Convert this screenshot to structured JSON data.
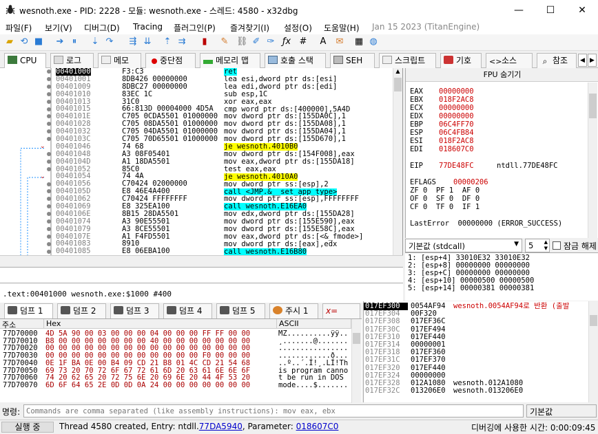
{
  "window": {
    "title": "wesnoth.exe - PID: 2228 - 모듈: wesnoth.exe - 스레드: 4580 - x32dbg",
    "minimize": "—",
    "maximize": "☐",
    "close": "✕"
  },
  "menu": [
    "파일(F)",
    "보기(V)",
    "디버그(D)",
    "Tracing",
    "플러그인(P)",
    "즐겨찾기(I)",
    "설정(O)",
    "도움말(H)"
  ],
  "menu_date": "Jan 15 2023 (TitanEngine)",
  "tabs": [
    {
      "label": "CPU",
      "icon": "cpu-icon"
    },
    {
      "label": "로그",
      "icon": "log-icon"
    },
    {
      "label": "메모",
      "icon": "notes-icon"
    },
    {
      "label": "중단점",
      "icon": "breakpoint-icon"
    },
    {
      "label": "메모리 맵",
      "icon": "memory-map-icon"
    },
    {
      "label": "호출 스택",
      "icon": "call-stack-icon"
    },
    {
      "label": "SEH",
      "icon": "seh-icon"
    },
    {
      "label": "스크립트",
      "icon": "script-icon"
    },
    {
      "label": "기호",
      "icon": "symbols-icon"
    },
    {
      "label": "소스",
      "icon": "source-icon"
    },
    {
      "label": "참조",
      "icon": "references-icon"
    }
  ],
  "disasm": {
    "rows": [
      {
        "addr": "00401000",
        "bytes": "F3:C3",
        "ins": "ret",
        "style": "ret",
        "cur": true
      },
      {
        "addr": "00401001",
        "bytes": "8DB426 00000000",
        "ins": "lea esi,dword ptr ds:[esi]"
      },
      {
        "addr": "00401009",
        "bytes": "8DBC27 00000000",
        "ins": "lea edi,dword ptr ds:[edi]"
      },
      {
        "addr": "00401010",
        "bytes": "83EC 1C",
        "ins": "sub esp,1C"
      },
      {
        "addr": "00401013",
        "bytes": "31C0",
        "ins": "xor eax,eax"
      },
      {
        "addr": "00401015",
        "bytes": "66:813D 00004000 4D5A",
        "ins": "cmp word ptr ds:[400000],5A4D"
      },
      {
        "addr": "0040101E",
        "bytes": "C705 0CDA5501 01000000",
        "ins": "mov dword ptr ds:[155DA0C],1"
      },
      {
        "addr": "00401028",
        "bytes": "C705 08DA5501 01000000",
        "ins": "mov dword ptr ds:[155DA08],1"
      },
      {
        "addr": "00401032",
        "bytes": "C705 04DA5501 01000000",
        "ins": "mov dword ptr ds:[155DA04],1"
      },
      {
        "addr": "0040103C",
        "bytes": "C705 70D65501 01000000",
        "ins": "mov dword ptr ds:[155D670],1"
      },
      {
        "addr": "00401046",
        "bytes": "74 68",
        "ins": "je wesnoth.4010B0",
        "style": "jmp"
      },
      {
        "addr": "00401048",
        "bytes": "A3 08F05401",
        "ins": "mov dword ptr ds:[154F008],eax"
      },
      {
        "addr": "0040104D",
        "bytes": "A1 18DA5501",
        "ins": "mov eax,dword ptr ds:[155DA18]"
      },
      {
        "addr": "00401052",
        "bytes": "85C0",
        "ins": "test eax,eax"
      },
      {
        "addr": "00401054",
        "bytes": "74 4A",
        "ins": "je wesnoth.4010A0",
        "style": "jmp"
      },
      {
        "addr": "00401056",
        "bytes": "C70424 02000000",
        "ins": "mov dword ptr ss:[esp],2"
      },
      {
        "addr": "0040105D",
        "bytes": "E8 46E4A400",
        "ins": "call <JMP.&__set_app_type>",
        "style": "call"
      },
      {
        "addr": "00401062",
        "bytes": "C70424 FFFFFFFF",
        "ins": "mov dword ptr ss:[esp],FFFFFFFF"
      },
      {
        "addr": "00401069",
        "bytes": "E8 325EA100",
        "ins": "call wesnoth.E16EA0",
        "style": "call"
      },
      {
        "addr": "0040106E",
        "bytes": "8B15 28DA5501",
        "ins": "mov edx,dword ptr ds:[155DA28]"
      },
      {
        "addr": "00401074",
        "bytes": "A3 90E55501",
        "ins": "mov dword ptr ds:[155E590],eax"
      },
      {
        "addr": "00401079",
        "bytes": "A3 8CE55501",
        "ins": "mov dword ptr ds:[155E58C],eax"
      },
      {
        "addr": "0040107E",
        "bytes": "A1 F4FD5501",
        "ins": "mov eax,dword ptr ds:[<&_fmode>]"
      },
      {
        "addr": "00401083",
        "bytes": "8910",
        "ins": "mov dword ptr ds:[eax],edx"
      },
      {
        "addr": "00401085",
        "bytes": "E8 06EBA100",
        "ins": "call wesnoth.E16B80",
        "style": "call"
      }
    ]
  },
  "info": {
    "line": ".text:00401000 wesnoth.exe:$1000 #400"
  },
  "fpu": {
    "header": "FPU 숨기기",
    "regs": [
      {
        "n": "EAX",
        "v": "00000000"
      },
      {
        "n": "EBX",
        "v": "018F2AC8"
      },
      {
        "n": "ECX",
        "v": "00000000"
      },
      {
        "n": "EDX",
        "v": "00000000"
      },
      {
        "n": "EBP",
        "v": "06C4FF70"
      },
      {
        "n": "ESP",
        "v": "06C4FB84"
      },
      {
        "n": "ESI",
        "v": "018F2AC8"
      },
      {
        "n": "EDI",
        "v": "018607C0"
      }
    ],
    "eip": {
      "n": "EIP",
      "v": "77DE48FC",
      "c": "ntdll.77DE48FC"
    },
    "eflags": {
      "n": "EFLAGS",
      "v": "00000206"
    },
    "flags": [
      "ZF 0  PF 1  AF 0",
      "OF 0  SF 0  DF 0",
      "CF 0  TF 0  IF 1"
    ],
    "lasterror": "LastError  00000000 (ERROR_SUCCESS)"
  },
  "stackargs": {
    "callconv": "기본값 (stdcall)",
    "count": "5",
    "unlock_label": "잠금 해제",
    "rows": [
      "1: [esp+4] 33010E32 33010E32",
      "2: [esp+8] 00000000 00000000",
      "3: [esp+C] 00000000 00000000",
      "4: [esp+10] 00000500 00000500",
      "5: [esp+14] 00000381 00000381"
    ]
  },
  "dumptabs": [
    "덤프 1",
    "덤프 2",
    "덤프 3",
    "덤프 4",
    "덤프 5",
    "주시 1"
  ],
  "dump": {
    "h_addr": "주소",
    "h_hex": "Hex",
    "h_ascii": "ASCII",
    "rows": [
      {
        "a": "77D70000",
        "h": "4D 5A 90 00 03 00 00 00 04 00 00 00 FF FF 00 00",
        "s": "MZ..........ÿÿ.."
      },
      {
        "a": "77D70010",
        "h": "B8 00 00 00 00 00 00 00 40 00 00 00 00 00 00 00",
        "s": "¸.......@......."
      },
      {
        "a": "77D70020",
        "h": "00 00 00 00 00 00 00 00 00 00 00 00 00 00 00 00",
        "s": "................"
      },
      {
        "a": "77D70030",
        "h": "00 00 00 00 00 00 00 00 00 00 00 00 F0 00 00 00",
        "s": "............ð..."
      },
      {
        "a": "77D70040",
        "h": "0E 1F BA 0E 00 B4 09 CD 21 B8 01 4C CD 21 54 68",
        "s": "..º..´.Í!¸.LÍ!Th"
      },
      {
        "a": "77D70050",
        "h": "69 73 20 70 72 6F 67 72 61 6D 20 63 61 6E 6E 6F",
        "s": "is program canno"
      },
      {
        "a": "77D70060",
        "h": "74 20 62 65 20 72 75 6E 20 69 6E 20 44 4F 53 20",
        "s": "t be run in DOS "
      },
      {
        "a": "77D70070",
        "h": "6D 6F 64 65 2E 0D 0D 0A 24 00 00 00 00 00 00 00",
        "s": "mode....$......."
      }
    ]
  },
  "stack": {
    "rows": [
      {
        "a": "017EF300",
        "v": "0054AF94",
        "c": "wesnoth.0054AF94로 반환 (출발",
        "cur": true
      },
      {
        "a": "017EF304",
        "v": "00F320",
        "c": ""
      },
      {
        "a": "017EF308",
        "v": "017EF36C",
        "c": ""
      },
      {
        "a": "017EF30C",
        "v": "017EF494",
        "c": ""
      },
      {
        "a": "017EF310",
        "v": "017EF440",
        "c": ""
      },
      {
        "a": "017EF314",
        "v": "00000001",
        "c": ""
      },
      {
        "a": "017EF318",
        "v": "017EF360",
        "c": ""
      },
      {
        "a": "017EF31C",
        "v": "017EF370",
        "c": ""
      },
      {
        "a": "017EF320",
        "v": "017EF440",
        "c": ""
      },
      {
        "a": "017EF324",
        "v": "00000000",
        "c": ""
      },
      {
        "a": "017EF328",
        "v": "012A1080",
        "c": "wesnoth.012A1080"
      },
      {
        "a": "017EF32C",
        "v": "013206E0",
        "c": "wesnoth.013206E0"
      }
    ]
  },
  "cmd": {
    "label": "명령:",
    "placeholder": "Commands are comma separated (like assembly instructions): mov eax, ebx",
    "mode": "기본값"
  },
  "status": {
    "state": "실행 중",
    "msg_prefix": "Thread 4580 created, Entry: ntdll.",
    "entry": "77DA5940",
    "msg_mid": ", Parameter: ",
    "param": "018607C0",
    "time": "디버깅에 사용한 시간: 0:00:09:45"
  }
}
